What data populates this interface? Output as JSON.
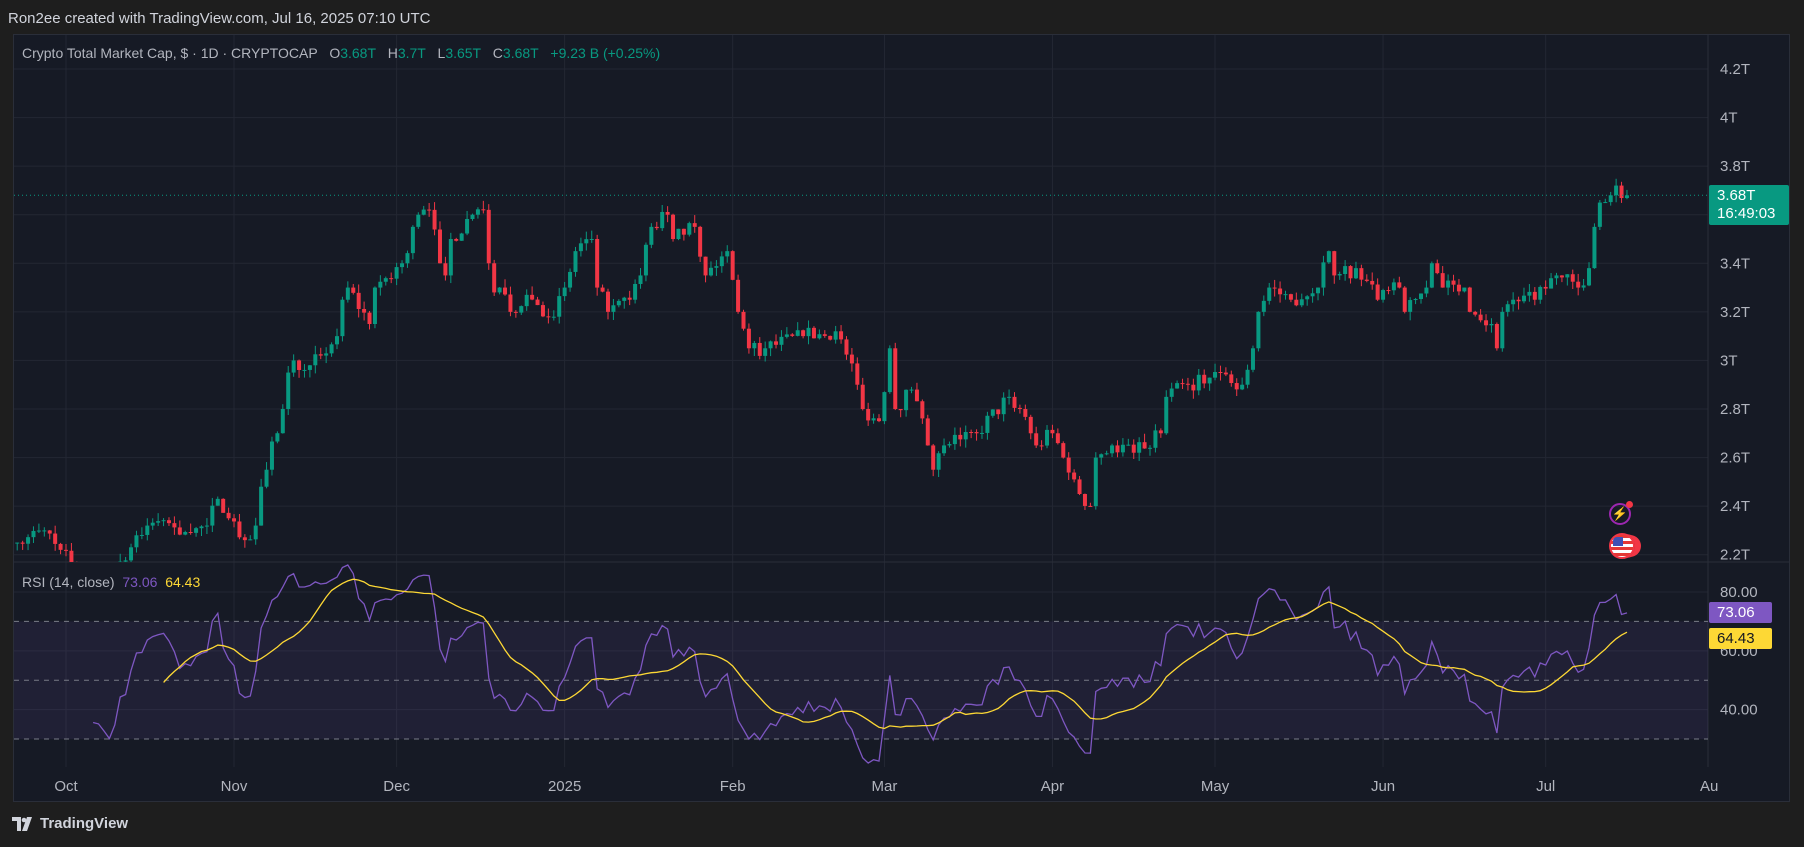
{
  "credit": "Ron2ee created with TradingView.com, Jul 16, 2025 07:10 UTC",
  "legend": {
    "symbol": "Crypto Total Market Cap, $ · 1D · CRYPTOCAP",
    "o_label": "O",
    "o": "3.68T",
    "h_label": "H",
    "h": "3.7T",
    "l_label": "L",
    "l": "3.65T",
    "c_label": "C",
    "c": "3.68T",
    "change": "+9.23 B (+0.25%)"
  },
  "last_price": {
    "value": "3.68T",
    "countdown": "16:49:03"
  },
  "rsi_legend": {
    "name": "RSI (14, close)",
    "rsi": "73.06",
    "ma": "64.43"
  },
  "brand": "TradingView",
  "colors": {
    "up": "#089981",
    "down": "#f23645",
    "rsi": "#7e57c2",
    "rsi_ma": "#fdd835",
    "background": "#161a25",
    "grid": "#232733"
  },
  "icons": [
    "lightning-event-icon",
    "us-flag-event-icon",
    "tradingview-logo-icon"
  ],
  "chart_data": [
    {
      "type": "candlestick",
      "title": "Crypto Total Market Cap",
      "interval": "1D",
      "unit": "T",
      "ylim": [
        2.17,
        4.34
      ],
      "y_ticks": [
        "2.2T",
        "2.4T",
        "2.6T",
        "2.8T",
        "3T",
        "3.2T",
        "3.4T",
        "3.6T",
        "3.8T",
        "4T",
        "4.2T"
      ],
      "y_tick_values": [
        2.2,
        2.4,
        2.6,
        2.8,
        3.0,
        3.2,
        3.4,
        3.6,
        3.8,
        4.0,
        4.2
      ],
      "x_ticks": [
        {
          "label": "Oct",
          "date": "2024-10-01"
        },
        {
          "label": "Nov",
          "date": "2024-11-01"
        },
        {
          "label": "Dec",
          "date": "2024-12-01"
        },
        {
          "label": "2025",
          "date": "2025-01-01"
        },
        {
          "label": "Feb",
          "date": "2025-02-01"
        },
        {
          "label": "Mar",
          "date": "2025-03-01"
        },
        {
          "label": "Apr",
          "date": "2025-04-01"
        },
        {
          "label": "May",
          "date": "2025-05-01"
        },
        {
          "label": "Jun",
          "date": "2025-06-01"
        },
        {
          "label": "Jul",
          "date": "2025-07-01"
        },
        {
          "label": "Au",
          "date": "2025-08-01"
        }
      ],
      "last_close": 3.68,
      "approx_closes": [
        [
          "2024-09-22",
          2.25
        ],
        [
          "2024-09-27",
          2.3
        ],
        [
          "2024-09-30",
          2.22
        ],
        [
          "2024-10-03",
          2.12
        ],
        [
          "2024-10-10",
          2.12
        ],
        [
          "2024-10-14",
          2.28
        ],
        [
          "2024-10-16",
          2.32
        ],
        [
          "2024-10-20",
          2.33
        ],
        [
          "2024-10-24",
          2.29
        ],
        [
          "2024-10-27",
          2.32
        ],
        [
          "2024-10-29",
          2.43
        ],
        [
          "2024-10-31",
          2.35
        ],
        [
          "2024-11-03",
          2.26
        ],
        [
          "2024-11-05",
          2.32
        ],
        [
          "2024-11-06",
          2.48
        ],
        [
          "2024-11-07",
          2.55
        ],
        [
          "2024-11-10",
          2.8
        ],
        [
          "2024-11-11",
          2.95
        ],
        [
          "2024-11-12",
          3.0
        ],
        [
          "2024-11-15",
          2.98
        ],
        [
          "2024-11-17",
          3.02
        ],
        [
          "2024-11-20",
          3.1
        ],
        [
          "2024-11-21",
          3.25
        ],
        [
          "2024-11-22",
          3.3
        ],
        [
          "2024-11-26",
          3.15
        ],
        [
          "2024-11-27",
          3.3
        ],
        [
          "2024-12-02",
          3.4
        ],
        [
          "2024-12-04",
          3.55
        ],
        [
          "2024-12-05",
          3.6
        ],
        [
          "2024-12-07",
          3.62
        ],
        [
          "2024-12-09",
          3.4
        ],
        [
          "2024-12-10",
          3.35
        ],
        [
          "2024-12-11",
          3.5
        ],
        [
          "2024-12-15",
          3.6
        ],
        [
          "2024-12-17",
          3.62
        ],
        [
          "2024-12-18",
          3.4
        ],
        [
          "2024-12-19",
          3.28
        ],
        [
          "2024-12-20",
          3.3
        ],
        [
          "2024-12-22",
          3.2
        ],
        [
          "2024-12-25",
          3.27
        ],
        [
          "2024-12-30",
          3.18
        ],
        [
          "2025-01-01",
          3.3
        ],
        [
          "2025-01-03",
          3.45
        ],
        [
          "2025-01-06",
          3.5
        ],
        [
          "2025-01-07",
          3.3
        ],
        [
          "2025-01-09",
          3.2
        ],
        [
          "2025-01-13",
          3.25
        ],
        [
          "2025-01-15",
          3.35
        ],
        [
          "2025-01-17",
          3.55
        ],
        [
          "2025-01-20",
          3.6
        ],
        [
          "2025-01-21",
          3.5
        ],
        [
          "2025-01-25",
          3.55
        ],
        [
          "2025-01-27",
          3.35
        ],
        [
          "2025-01-31",
          3.45
        ],
        [
          "2025-02-02",
          3.2
        ],
        [
          "2025-02-04",
          3.05
        ],
        [
          "2025-02-07",
          3.05
        ],
        [
          "2025-02-14",
          3.1
        ],
        [
          "2025-02-20",
          3.12
        ],
        [
          "2025-02-24",
          2.9
        ],
        [
          "2025-02-25",
          2.8
        ],
        [
          "2025-02-28",
          2.75
        ],
        [
          "2025-03-02",
          3.05
        ],
        [
          "2025-03-03",
          2.8
        ],
        [
          "2025-03-06",
          2.88
        ],
        [
          "2025-03-09",
          2.65
        ],
        [
          "2025-03-10",
          2.55
        ],
        [
          "2025-03-12",
          2.65
        ],
        [
          "2025-03-18",
          2.7
        ],
        [
          "2025-03-24",
          2.85
        ],
        [
          "2025-03-26",
          2.8
        ],
        [
          "2025-03-29",
          2.65
        ],
        [
          "2025-04-01",
          2.7
        ],
        [
          "2025-04-03",
          2.6
        ],
        [
          "2025-04-06",
          2.45
        ],
        [
          "2025-04-08",
          2.4
        ],
        [
          "2025-04-09",
          2.6
        ],
        [
          "2025-04-12",
          2.65
        ],
        [
          "2025-04-16",
          2.62
        ],
        [
          "2025-04-21",
          2.7
        ],
        [
          "2025-04-22",
          2.85
        ],
        [
          "2025-04-26",
          2.9
        ],
        [
          "2025-05-02",
          2.95
        ],
        [
          "2025-05-06",
          2.9
        ],
        [
          "2025-05-08",
          3.05
        ],
        [
          "2025-05-09",
          3.2
        ],
        [
          "2025-05-11",
          3.3
        ],
        [
          "2025-05-15",
          3.25
        ],
        [
          "2025-05-20",
          3.3
        ],
        [
          "2025-05-22",
          3.45
        ],
        [
          "2025-05-23",
          3.35
        ],
        [
          "2025-05-27",
          3.38
        ],
        [
          "2025-05-31",
          3.25
        ],
        [
          "2025-06-04",
          3.3
        ],
        [
          "2025-06-05",
          3.2
        ],
        [
          "2025-06-09",
          3.3
        ],
        [
          "2025-06-10",
          3.4
        ],
        [
          "2025-06-12",
          3.3
        ],
        [
          "2025-06-16",
          3.3
        ],
        [
          "2025-06-17",
          3.2
        ],
        [
          "2025-06-21",
          3.15
        ],
        [
          "2025-06-22",
          3.05
        ],
        [
          "2025-06-23",
          3.2
        ],
        [
          "2025-06-25",
          3.25
        ],
        [
          "2025-06-29",
          3.25
        ],
        [
          "2025-07-03",
          3.35
        ],
        [
          "2025-07-07",
          3.3
        ],
        [
          "2025-07-09",
          3.38
        ],
        [
          "2025-07-10",
          3.55
        ],
        [
          "2025-07-11",
          3.65
        ],
        [
          "2025-07-13",
          3.68
        ],
        [
          "2025-07-14",
          3.72
        ],
        [
          "2025-07-16",
          3.68
        ]
      ]
    },
    {
      "type": "line",
      "title": "RSI (14, close)",
      "ylim": [
        20.5,
        90.2
      ],
      "y_ticks": [
        "40.00",
        "60.00",
        "80.00"
      ],
      "y_tick_values": [
        40,
        60,
        80
      ],
      "bands": [
        30,
        50,
        70
      ],
      "series": [
        {
          "name": "RSI",
          "last": 73.06
        },
        {
          "name": "RSI-based MA",
          "last": 64.43
        }
      ]
    }
  ]
}
